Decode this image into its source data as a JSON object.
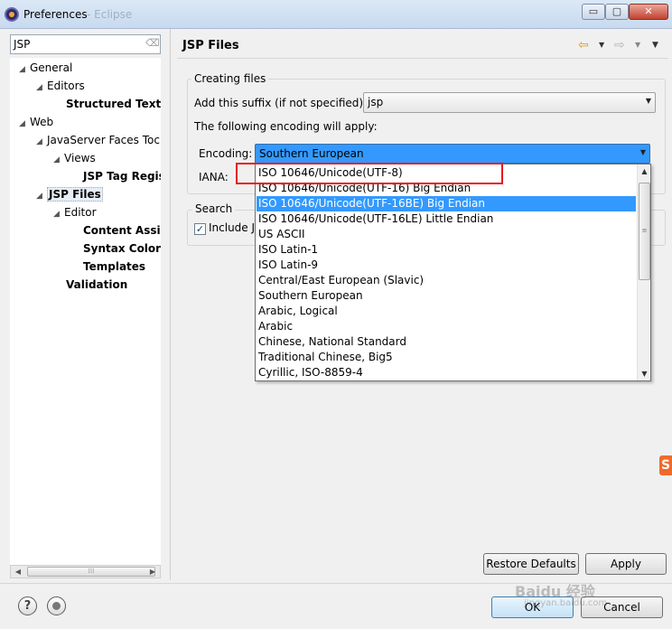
{
  "window": {
    "title": "Preferences",
    "title_suffix": "- Eclipse",
    "min_label": "▭",
    "max_label": "▢",
    "close_label": "✕"
  },
  "filter": {
    "value": "JSP"
  },
  "tree": {
    "items": [
      {
        "label": "General",
        "toggle": "◢",
        "bold": false
      },
      {
        "label": "Editors",
        "toggle": "◢",
        "bold": false
      },
      {
        "label": "Structured Text E",
        "toggle": "",
        "bold": true
      },
      {
        "label": "Web",
        "toggle": "◢",
        "bold": false
      },
      {
        "label": "JavaServer Faces Toc",
        "toggle": "◢",
        "bold": false
      },
      {
        "label": "Views",
        "toggle": "◢",
        "bold": false
      },
      {
        "label": "JSP Tag Regis",
        "toggle": "",
        "bold": true
      },
      {
        "label": "JSP Files",
        "toggle": "◢",
        "bold": true,
        "selected": true
      },
      {
        "label": "Editor",
        "toggle": "◢",
        "bold": false
      },
      {
        "label": "Content Assis",
        "toggle": "",
        "bold": true
      },
      {
        "label": "Syntax Colori",
        "toggle": "",
        "bold": true
      },
      {
        "label": "Templates",
        "toggle": "",
        "bold": true
      },
      {
        "label": "Validation",
        "toggle": "",
        "bold": true
      }
    ]
  },
  "page": {
    "title": "JSP Files",
    "creating_files": {
      "legend": "Creating files",
      "suffix_label": "Add this suffix (if not specified):",
      "suffix_value": "jsp",
      "following_label": "The following encoding will apply:",
      "encoding_label": "Encoding:",
      "encoding_value": "Southern European",
      "iana_label": "IANA:"
    },
    "search": {
      "legend": "Search",
      "include_label": "Include J",
      "include_checked": "✓"
    }
  },
  "encoding_dropdown": {
    "options": [
      "ISO 10646/Unicode(UTF-8)",
      "ISO 10646/Unicode(UTF-16) Big Endian",
      "ISO 10646/Unicode(UTF-16BE) Big Endian",
      "ISO 10646/Unicode(UTF-16LE) Little Endian",
      "US ASCII",
      "ISO Latin-1",
      "ISO Latin-9",
      "Central/East European (Slavic)",
      "Southern European",
      "Arabic, Logical",
      "Arabic",
      "Chinese, National Standard",
      "Traditional Chinese, Big5",
      "Cyrillic, ISO-8859-4"
    ],
    "highlighted": "ISO 10646/Unicode(UTF-16BE) Big Endian",
    "annotated": "ISO 10646/Unicode(UTF-8)"
  },
  "buttons": {
    "restore": "Restore Defaults",
    "apply": "Apply",
    "ok": "OK",
    "cancel": "Cancel"
  },
  "icons": {
    "help": "?",
    "side_logo": "S"
  },
  "watermark": {
    "text": "Baidu 经验",
    "url": "jingyan.baidu.com"
  },
  "colors": {
    "selection": "#3399ff",
    "annotation_border": "#e81919",
    "nav_back": "#d99a1c"
  }
}
